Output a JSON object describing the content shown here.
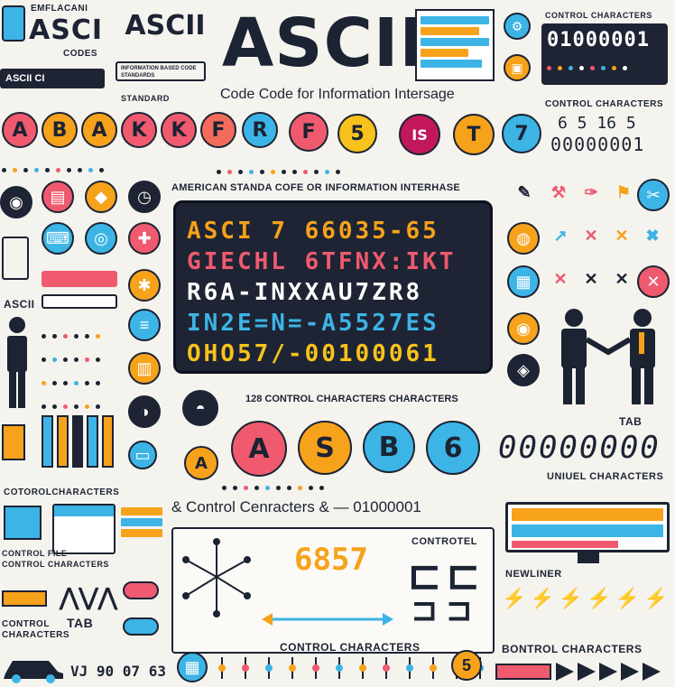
{
  "header": {
    "badge_top": "EMFLACANI",
    "logo_small": "ASCI",
    "codes_label": "CODES",
    "banner_1": "ASCII",
    "title": "ASCII",
    "subtitle": "Code Code for Information Intersage",
    "left_tag": "ASCII CI",
    "stand_label": "STANDARD",
    "mini_note": "INFORMATION BASED CODE STANDARDS"
  },
  "top_right": {
    "control_title": "CONTROL CHARACTERS",
    "binary_1": "01000001",
    "control_title_2": "CONTROL CHARACTERS",
    "numbers": "6 5 16 5",
    "binary_2": "00000001"
  },
  "letter_circles": [
    {
      "char": "A",
      "color": "#ef5a6f"
    },
    {
      "char": "B",
      "color": "#f7a21b"
    },
    {
      "char": "A",
      "color": "#f7a21b"
    },
    {
      "char": "K",
      "color": "#ef5a6f"
    },
    {
      "char": "K",
      "color": "#ef5a6f"
    },
    {
      "char": "R",
      "color": "#3db4e6"
    },
    {
      "char": "F",
      "color": "#f26b5b"
    },
    {
      "char": "5",
      "color": "#f7c21b"
    },
    {
      "char": "IS",
      "color": "#c2185b"
    },
    {
      "char": "T",
      "color": "#f7a21b"
    },
    {
      "char": "7",
      "color": "#3db4e6"
    }
  ],
  "panel": {
    "heading": "AMERICAN STANDA COFE OR INFORMATION INTERHASE",
    "lines": [
      "ASCI 7 66035-65",
      "GIECHL 6TFNX:IKT",
      "R6A-INXXAU7ZR8",
      "IN2E=N=-A5527ES",
      "OHO57/-00100061"
    ]
  },
  "mid_labels": {
    "chars_128": "128 CONTROL CHARACTERS CHARACTERS",
    "tab": "TAB",
    "big_binary": "00000000",
    "uniuel": "UNIUEL CHARACTERS",
    "control_text": "& Control Cenracters &  — 01000001",
    "controtel": "CONTROTEL",
    "num_687": "6857",
    "newliner": "NEWLINER",
    "control_chars_bottom": "CONTROL CHARACTERS",
    "bontrol": "BONTROL CHARACTERS",
    "tab_left": "TAB",
    "control_left": "CONTROL CHARACTERS",
    "cotorol": "COTOROLCHARACTERS",
    "control_fle": "CONTROL FILE",
    "control_fle_2": "CONTROL CHARACTERS",
    "ascii_left": "ASCII",
    "bottom_nums": "VJ 90 07 63",
    "abc_circles": [
      "A",
      "A",
      "S",
      "B",
      "6"
    ]
  },
  "colors": {
    "red": "#ef5a6f",
    "orange": "#f7a21b",
    "blue": "#3db4e6",
    "navy": "#1e2433",
    "yellow": "#f7c21b"
  }
}
